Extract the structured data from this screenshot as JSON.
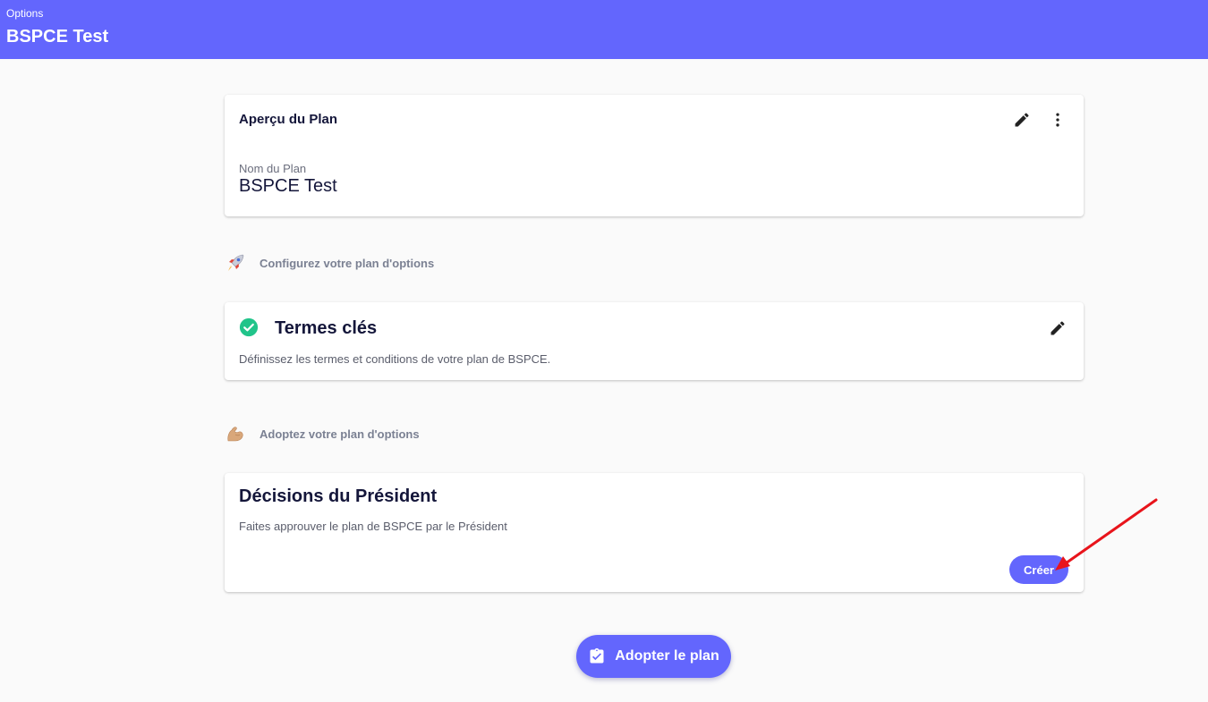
{
  "header": {
    "breadcrumb": "Options",
    "title": "BSPCE Test",
    "background_color": "#6366fd"
  },
  "overview": {
    "title": "Aperçu du Plan",
    "edit_icon": "pencil-icon",
    "more_icon": "more-vertical-icon",
    "field_label": "Nom du Plan",
    "field_value": "BSPCE Test"
  },
  "section_configure": {
    "emoji": "rocket-icon",
    "label": "Configurez votre plan d'options"
  },
  "terms": {
    "status_icon": "check-circle-icon",
    "status_color": "#21c48a",
    "title": "Termes clés",
    "description": "Définissez les termes et conditions de votre plan de BSPCE.",
    "edit_icon": "pencil-icon"
  },
  "section_adopt": {
    "emoji": "flexed-biceps-icon",
    "label": "Adoptez votre plan d'options"
  },
  "decisions": {
    "title": "Décisions du Président",
    "description": "Faites approuver le plan de BSPCE par le Président",
    "create_label": "Créer"
  },
  "annotation": {
    "arrow_color": "#e8141b"
  },
  "adopt_button": {
    "icon": "clipboard-check-icon",
    "label": "Adopter le plan",
    "accent_color": "#6366fd"
  }
}
